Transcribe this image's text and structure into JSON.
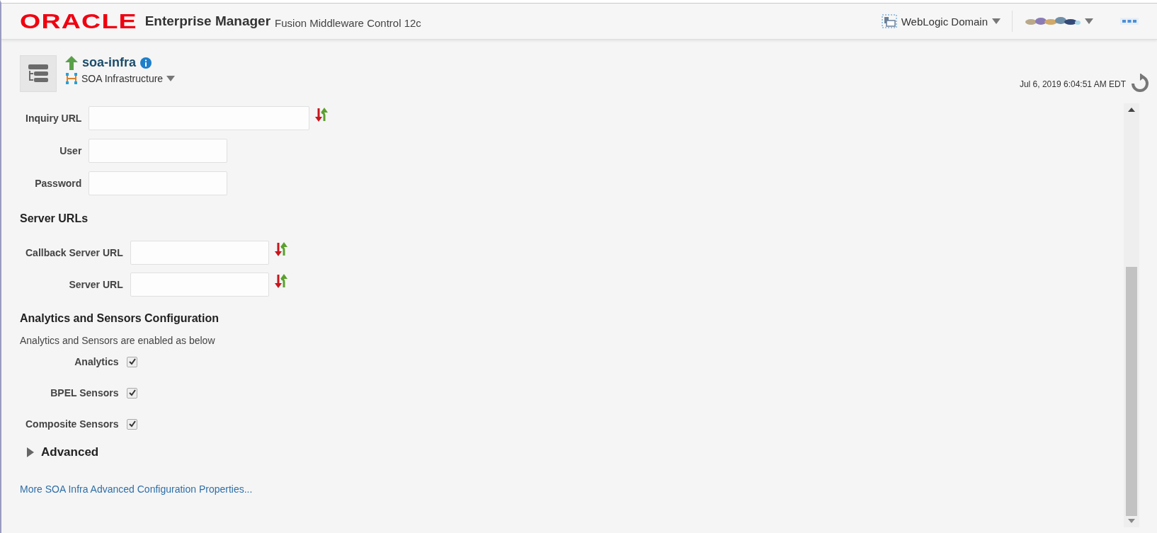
{
  "header": {
    "logo": "ORACLE",
    "product": "Enterprise Manager",
    "subtitle": "Fusion Middleware Control 12c",
    "domain_menu": "WebLogic Domain"
  },
  "target": {
    "name": "soa-infra",
    "type_menu": "SOA Infrastructure",
    "timestamp": "Jul 6, 2019 6:04:51 AM EDT"
  },
  "uddi_fields": [
    {
      "label": "Inquiry URL",
      "wide": true,
      "has_action": true
    },
    {
      "label": "User",
      "wide": false,
      "has_action": false
    },
    {
      "label": "Password",
      "wide": false,
      "has_action": false
    }
  ],
  "server_urls": {
    "heading": "Server URLs",
    "fields": [
      {
        "label": "Callback Server URL",
        "has_action": true
      },
      {
        "label": "Server URL",
        "has_action": true
      }
    ]
  },
  "analytics": {
    "heading": "Analytics and Sensors Configuration",
    "description": "Analytics and Sensors are enabled as below",
    "options": [
      {
        "label": "Analytics",
        "checked": true
      },
      {
        "label": "BPEL Sensors",
        "checked": true
      },
      {
        "label": "Composite Sensors",
        "checked": true
      }
    ]
  },
  "advanced": {
    "label": "Advanced",
    "expanded": false
  },
  "more_link": "More SOA Infra Advanced Configuration Properties..."
}
